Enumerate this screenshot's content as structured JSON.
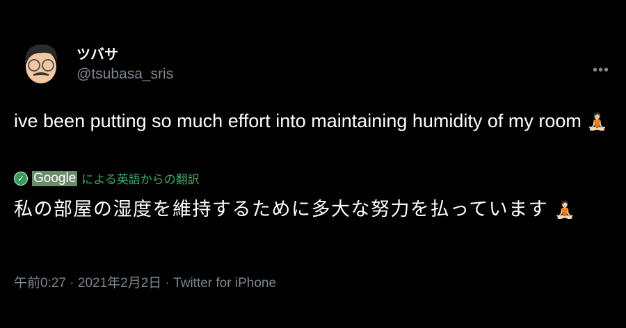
{
  "author": {
    "name": "ツバサ",
    "handle": "@tsubasa_sris"
  },
  "more_icon": "ellipsis-icon",
  "tweet": {
    "text": "ive been putting so much effort into maintaining humidity of my room",
    "emoji": "🧘🏻"
  },
  "translation": {
    "badge": "Google",
    "label": "による英語からの翻訳",
    "text": "私の部屋の湿度を維持するために多大な努力を払っています",
    "emoji": "🧘🏻",
    "accent": "#3fae6a"
  },
  "footer": {
    "time": "午前0:27",
    "sep1": " · ",
    "date": "2021年2月2日",
    "sep2": " · ",
    "source": "Twitter for iPhone"
  }
}
